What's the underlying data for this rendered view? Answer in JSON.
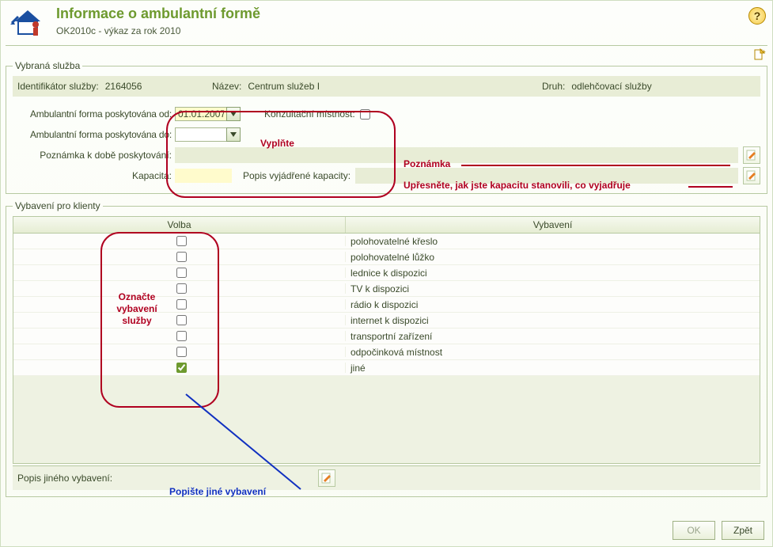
{
  "header": {
    "title": "Informace o ambulantní formě",
    "subtitle": "OK2010c - výkaz za rok 2010"
  },
  "icons": {
    "help_tooltip": "?",
    "home_name": "home-icon",
    "new_name": "new-doc-icon"
  },
  "service_group": {
    "legend": "Vybraná služba",
    "id_label": "Identifikátor služby:",
    "id_value": "2164056",
    "name_label": "Název:",
    "name_value": "Centrum služeb I",
    "type_label": "Druh:",
    "type_value": "odlehčovací služby"
  },
  "form": {
    "from_label": "Ambulantní forma poskytována od:",
    "from_value": "01.01.2007",
    "konzult_label": "Konzultační místnost:",
    "konzult_checked": false,
    "to_label": "Ambulantní forma poskytována do:",
    "to_value": "",
    "note_label": "Poznámka k době poskytování:",
    "note_value": "",
    "capacity_label": "Kapacita:",
    "capacity_value": "",
    "capacity_desc_label": "Popis vyjádřené kapacity:",
    "capacity_desc_value": ""
  },
  "equipment": {
    "legend": "Vybavení pro klienty",
    "col_choice": "Volba",
    "col_item": "Vybavení",
    "rows": [
      {
        "checked": false,
        "label": "polohovatelné křeslo"
      },
      {
        "checked": false,
        "label": "polohovatelné lůžko"
      },
      {
        "checked": false,
        "label": "lednice k dispozici"
      },
      {
        "checked": false,
        "label": "TV k dispozici"
      },
      {
        "checked": false,
        "label": "rádio k dispozici"
      },
      {
        "checked": false,
        "label": "internet k dispozici"
      },
      {
        "checked": false,
        "label": "transportní zařízení"
      },
      {
        "checked": false,
        "label": "odpočinková místnost"
      },
      {
        "checked": true,
        "label": "jiné"
      }
    ],
    "other_label": "Popis jiného vybavení:",
    "other_value": ""
  },
  "annotations": {
    "vyplnte": "Vyplňte",
    "poznamka": "Poznámka",
    "upresnete": "Upřesněte, jak jste kapacitu stanovili, co vyjadřuje",
    "oznacte": "Označte vybavení služby",
    "popiste": "Popište jiné vybavení"
  },
  "buttons": {
    "ok": "OK",
    "back": "Zpět"
  },
  "colors": {
    "accent_green": "#6e9a2f",
    "panel_border": "#b7c9a1",
    "highlight_yellow": "#fffbcc",
    "olive_row": "#e8edd6",
    "anno_red": "#b00020",
    "anno_blue": "#1030c0"
  }
}
